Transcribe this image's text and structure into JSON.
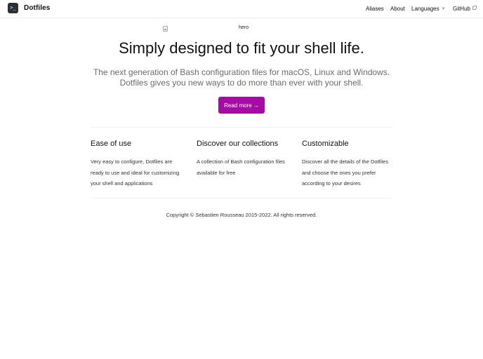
{
  "navbar": {
    "brand": "Dotfiles",
    "logo_glyph": ">_",
    "links": [
      {
        "label": "Aliases"
      },
      {
        "label": "About"
      },
      {
        "label": "Languages"
      },
      {
        "label": "GitHub"
      }
    ]
  },
  "hero": {
    "image_alt": "hero",
    "headline": "Simply designed to fit your shell life.",
    "lead_line_1": "The next generation of Bash configuration files for macOS, Linux and Windows.",
    "lead_line_2": "Dotfiles gives you new ways to do more than ever with your shell.",
    "cta_label": "Read more →"
  },
  "features": [
    {
      "title": "Ease of use",
      "lines": [
        "Very easy to configure, Dotfiles are",
        "ready to use and ideal for customizing",
        "your shell and applications"
      ]
    },
    {
      "title": "Discover our collections",
      "lines": [
        "A collection of Bash configuration files",
        "available for free"
      ]
    },
    {
      "title": "Customizable",
      "lines": [
        "Discover all the details of the Dotfiles",
        "and choose the ones you prefer",
        "according to your desires"
      ]
    }
  ],
  "footer": {
    "copyright": "Copyright © Sebastien Rousseau 2015-2022. All rights reserved."
  },
  "colors": {
    "accent": "#a40ca4",
    "logo_bg": "#2b2f36"
  }
}
